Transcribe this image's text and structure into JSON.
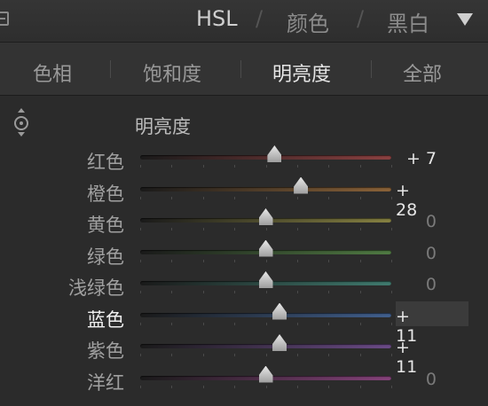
{
  "header": {
    "tabs": [
      {
        "label": "HSL",
        "state": "active"
      },
      {
        "label": "颜色",
        "state": "inactive"
      },
      {
        "label": "黑白",
        "state": "inactive"
      }
    ],
    "separator": "/",
    "collapse_icon": "collapse-square-icon",
    "toggle_icon": "triangle-down-icon"
  },
  "tabs": [
    {
      "label": "色相",
      "active": false
    },
    {
      "label": "饱和度",
      "active": false
    },
    {
      "label": "明亮度",
      "active": true
    },
    {
      "label": "全部",
      "active": false
    }
  ],
  "section": {
    "title": "明亮度",
    "target_icon": "targeted-adjustment-icon"
  },
  "sliders": [
    {
      "label": "红色",
      "value_text": "+ 7",
      "value": 7,
      "color": "#8a4040",
      "active": false
    },
    {
      "label": "橙色",
      "value_text": "+ 28",
      "value": 28,
      "color": "#8a6238",
      "active": false
    },
    {
      "label": "黄色",
      "value_text": "0",
      "value": 0,
      "color": "#858041",
      "active": false
    },
    {
      "label": "绿色",
      "value_text": "0",
      "value": 0,
      "color": "#4f7a42",
      "active": false
    },
    {
      "label": "浅绿色",
      "value_text": "0",
      "value": 0,
      "color": "#3f7a6e",
      "active": false
    },
    {
      "label": "蓝色",
      "value_text": "+ 11",
      "value": 11,
      "color": "#405f8d",
      "active": true
    },
    {
      "label": "紫色",
      "value_text": "+ 11",
      "value": 11,
      "color": "#6a4a86",
      "active": false
    },
    {
      "label": "洋红",
      "value_text": "0",
      "value": 0,
      "color": "#85427a",
      "active": false
    }
  ],
  "slider_range": [
    -100,
    100
  ]
}
